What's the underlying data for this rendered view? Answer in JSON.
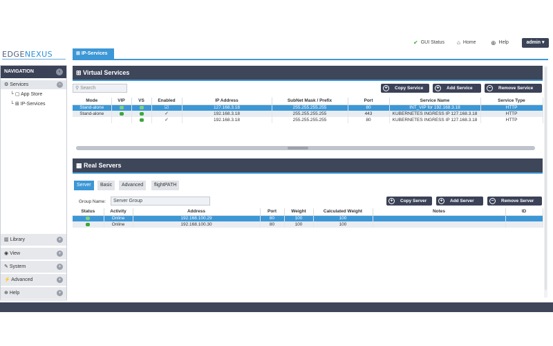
{
  "top": {
    "gui_status": "GUI Status",
    "home": "Home",
    "help": "Help",
    "admin": "admin"
  },
  "logo": {
    "part1": "EDGE",
    "part2": "NEXUS"
  },
  "page_tab": "IP-Services",
  "nav": {
    "title": "NAVIGATION",
    "services": "Services",
    "app_store": "App Store",
    "ip_services": "IP-Services",
    "library": "Library",
    "view": "View",
    "system": "System",
    "advanced": "Advanced",
    "help": "Help"
  },
  "virtual": {
    "title": "Virtual Services",
    "search_placeholder": "Search",
    "copy": "Copy Service",
    "add": "Add Service",
    "remove": "Remove Service",
    "columns": [
      "Mode",
      "VIP",
      "VS",
      "Enabled",
      "IP Address",
      "SubNet Mask / Prefix",
      "Port",
      "Service Name",
      "Service Type"
    ],
    "rows": [
      {
        "mode": "Stand-alone",
        "ip": "127.168.3.18",
        "mask": "255.255.255.255",
        "port": "80",
        "name": "INT_VIP for 192.168.3.18",
        "type": "HTTP"
      },
      {
        "mode": "Stand-alone",
        "ip": "192.168.3.18",
        "mask": "255.255.255.255",
        "port": "443",
        "name": "KUBERNETES INGRESS IP 127.168.3.18",
        "type": "HTTP"
      },
      {
        "mode": "",
        "ip": "192.168.3.18",
        "mask": "255.255.255.255",
        "port": "80",
        "name": "KUBERNETES INGRESS IP 127.168.3.18",
        "type": "HTTP"
      }
    ]
  },
  "real": {
    "title": "Real Servers",
    "tabs": [
      "Server",
      "Basic",
      "Advanced",
      "flightPATH"
    ],
    "group_label": "Group Name:",
    "group_value": "Server Group",
    "copy": "Copy Server",
    "add": "Add Server",
    "remove": "Remove Server",
    "columns": [
      "Status",
      "Activity",
      "Address",
      "Port",
      "Weight",
      "Calculated Weight",
      "Notes",
      "ID"
    ],
    "rows": [
      {
        "activity": "Online",
        "address": "192.168.100.29",
        "port": "80",
        "weight": "100",
        "calc": "100"
      },
      {
        "activity": "Online",
        "address": "192.168.100.30",
        "port": "80",
        "weight": "100",
        "calc": "100"
      }
    ]
  }
}
